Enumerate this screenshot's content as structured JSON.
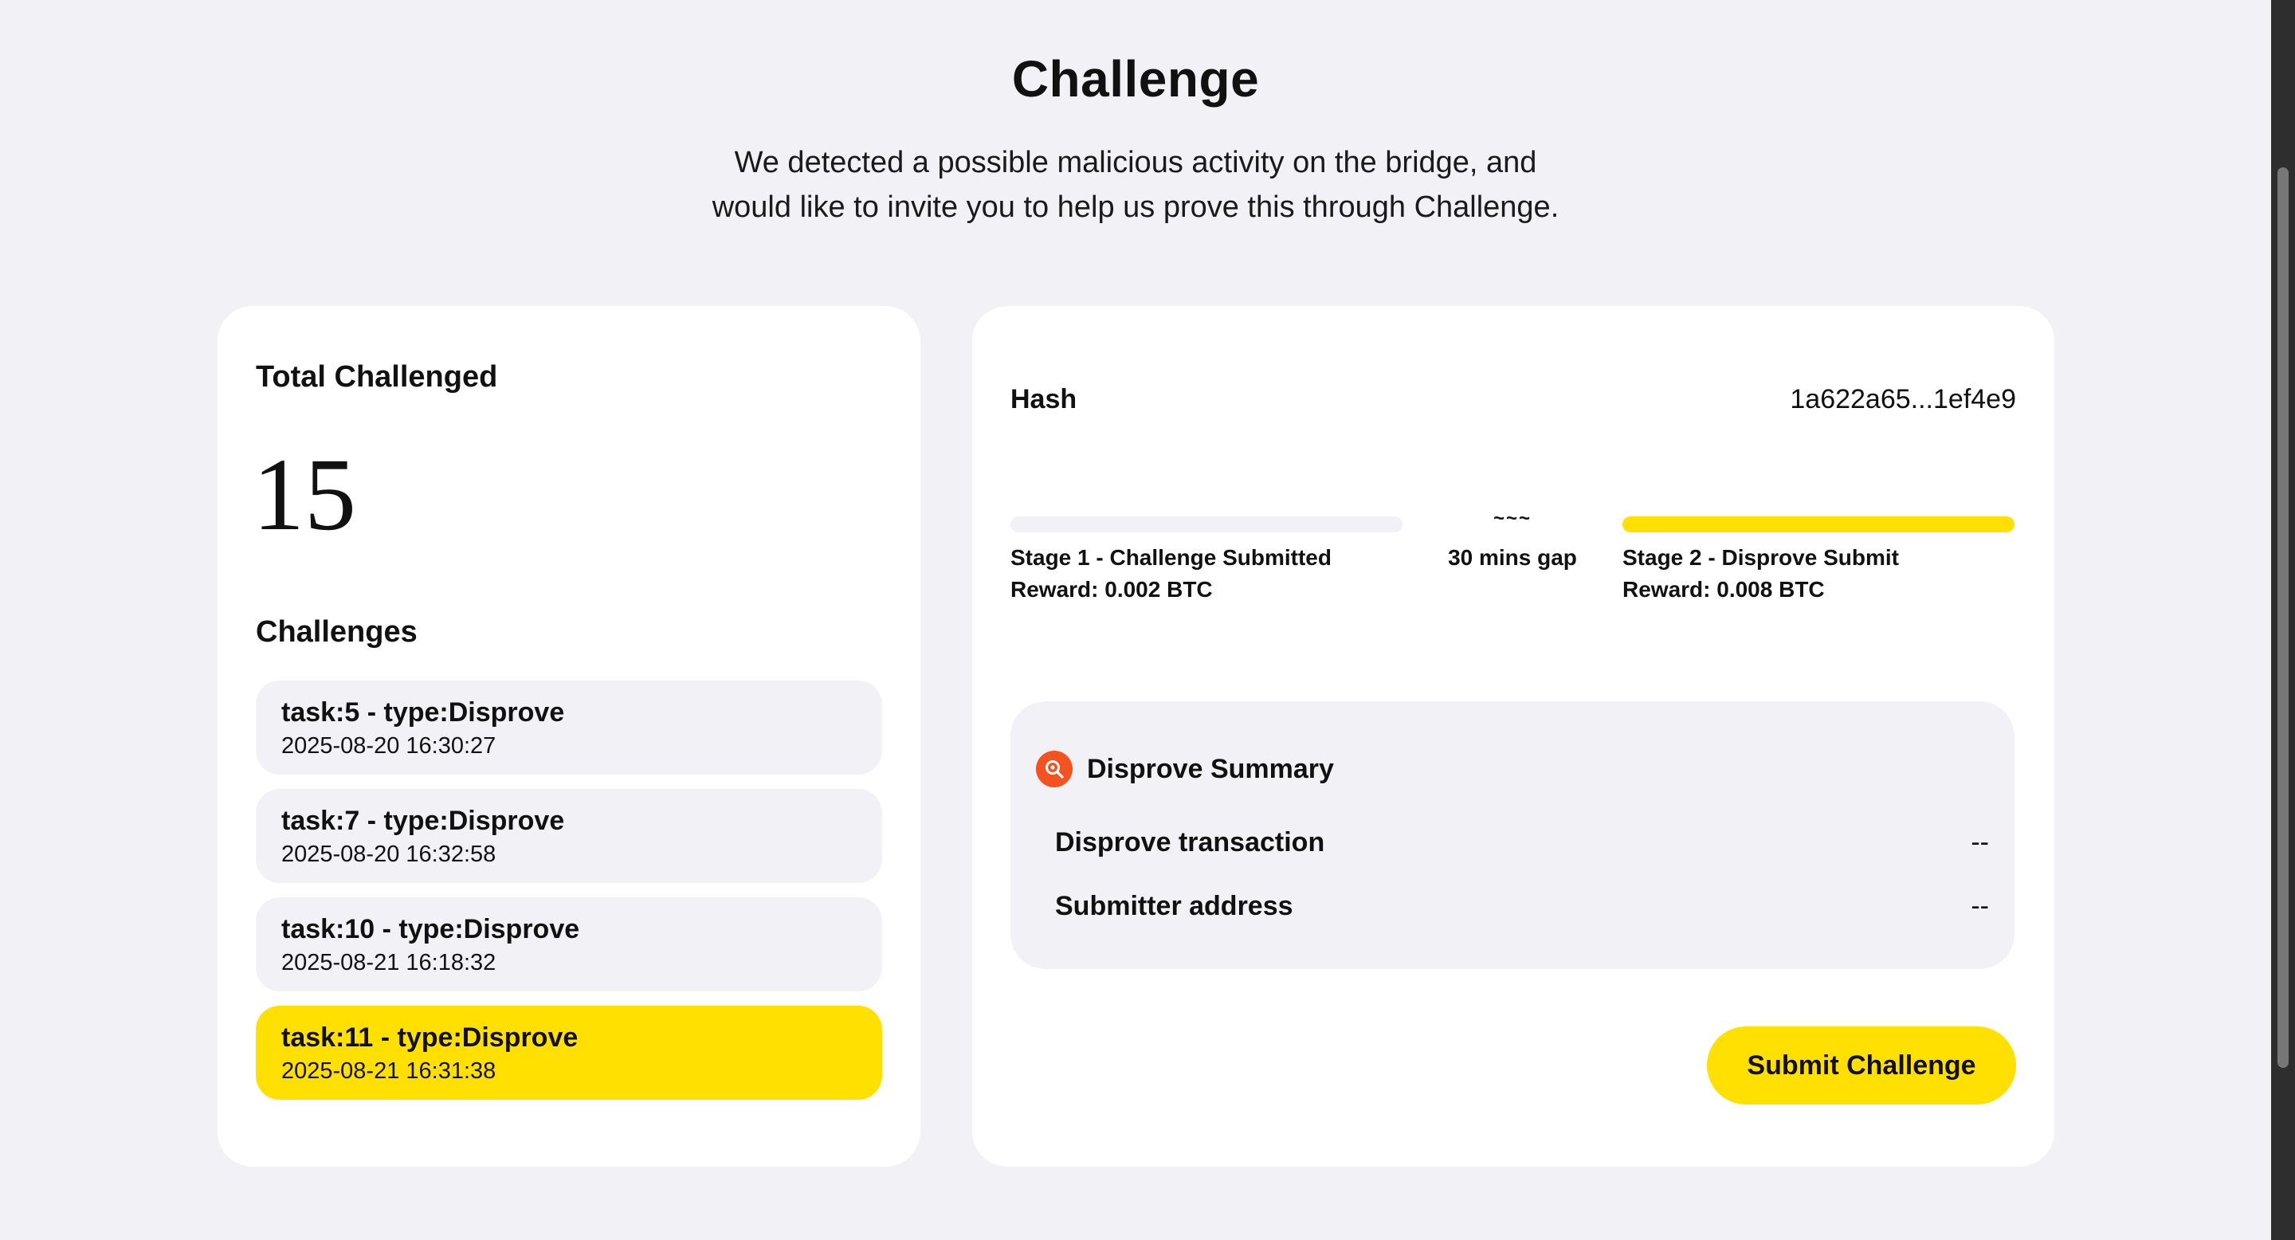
{
  "header": {
    "title": "Challenge",
    "subtitle_line1": "We detected a possible malicious activity on the bridge, and",
    "subtitle_line2": "would like to invite you to help us prove this through Challenge."
  },
  "left_panel": {
    "total_label": "Total Challenged",
    "total_count": "15",
    "challenges_label": "Challenges",
    "challenges": [
      {
        "title": "task:5 - type:Disprove",
        "date": "2025-08-20 16:30:27",
        "selected": false
      },
      {
        "title": "task:7 - type:Disprove",
        "date": "2025-08-20 16:32:58",
        "selected": false
      },
      {
        "title": "task:10 - type:Disprove",
        "date": "2025-08-21 16:18:32",
        "selected": false
      },
      {
        "title": "task:11 - type:Disprove",
        "date": "2025-08-21 16:31:38",
        "selected": true
      }
    ]
  },
  "right_panel": {
    "hash_label": "Hash",
    "hash_value": "1a622a65...1ef4e9",
    "stage1": {
      "title": "Stage 1 - Challenge Submitted",
      "reward": "Reward: 0.002 BTC",
      "active": false
    },
    "gap": {
      "icon": "~~~",
      "text": "30 mins gap"
    },
    "stage2": {
      "title": "Stage 2 - Disprove Submit",
      "reward": "Reward: 0.008 BTC",
      "active": true
    },
    "summary": {
      "icon": "search-icon",
      "title": "Disprove Summary",
      "rows": [
        {
          "label": "Disprove transaction",
          "value": "--"
        },
        {
          "label": "Submitter address",
          "value": "--"
        }
      ]
    },
    "submit_label": "Submit Challenge"
  },
  "colors": {
    "accent": "#ffe000",
    "background": "#f2f2f6",
    "card": "#ffffff",
    "summary_icon": "#f4521e"
  }
}
